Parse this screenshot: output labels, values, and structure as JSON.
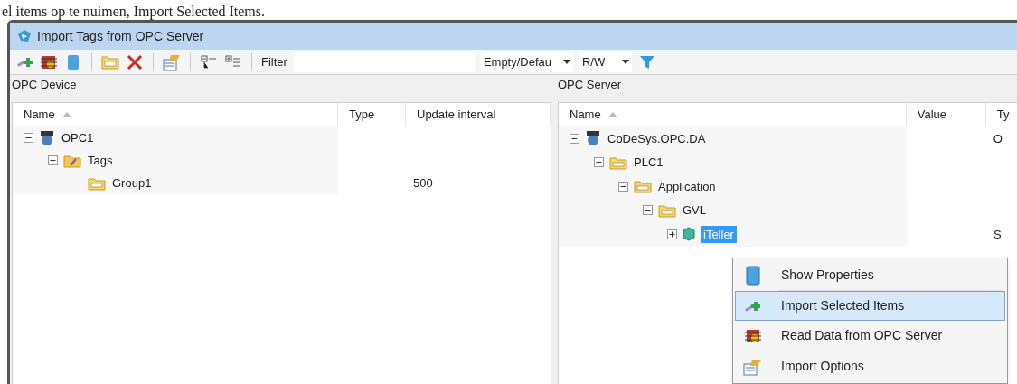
{
  "caption": "el items op te nuimen, Import Selected Items.",
  "window": {
    "title": "Import Tags from OPC Server"
  },
  "toolbar": {
    "filter_label": "Filter",
    "dropdowns": [
      {
        "value": "Empty/Defau"
      },
      {
        "value": "R/W"
      }
    ]
  },
  "left_panel": {
    "title": "OPC Device",
    "columns": [
      "Name",
      "Type",
      "Update interval"
    ],
    "tree": [
      {
        "label": "OPC1",
        "kind": "server",
        "expanded": true,
        "selected": false,
        "children": [
          {
            "label": "Tags",
            "kind": "tags",
            "expanded": true,
            "selected": false,
            "children": [
              {
                "label": "Group1",
                "kind": "folder",
                "selected": false,
                "update_interval": "500"
              }
            ]
          }
        ]
      }
    ]
  },
  "right_panel": {
    "title": "OPC Server",
    "columns": [
      "Name",
      "Value",
      "Ty"
    ],
    "tree": [
      {
        "label": "CoDeSys.OPC.DA",
        "kind": "server",
        "expanded": true,
        "selected": false,
        "column_3": "O",
        "children": [
          {
            "label": "PLC1",
            "kind": "folder",
            "expanded": true,
            "selected": false,
            "children": [
              {
                "label": "Application",
                "kind": "folder",
                "expanded": true,
                "selected": false,
                "children": [
                  {
                    "label": "GVL",
                    "kind": "folder",
                    "expanded": true,
                    "selected": false,
                    "children": [
                      {
                        "label": "iTeller",
                        "kind": "item",
                        "expanded": false,
                        "selected": true,
                        "column_3": "S"
                      }
                    ]
                  }
                ]
              }
            ]
          }
        ]
      }
    ]
  },
  "context_menu": [
    {
      "label": "Show Properties",
      "kind": "properties",
      "selected": false,
      "separator_after": true
    },
    {
      "label": "Import Selected Items",
      "kind": "import",
      "selected": true,
      "separator_after": false
    },
    {
      "label": "Read Data from OPC Server",
      "kind": "read",
      "selected": false,
      "separator_after": true
    },
    {
      "label": "Import Options",
      "kind": "options",
      "selected": false,
      "separator_after": false
    }
  ]
}
